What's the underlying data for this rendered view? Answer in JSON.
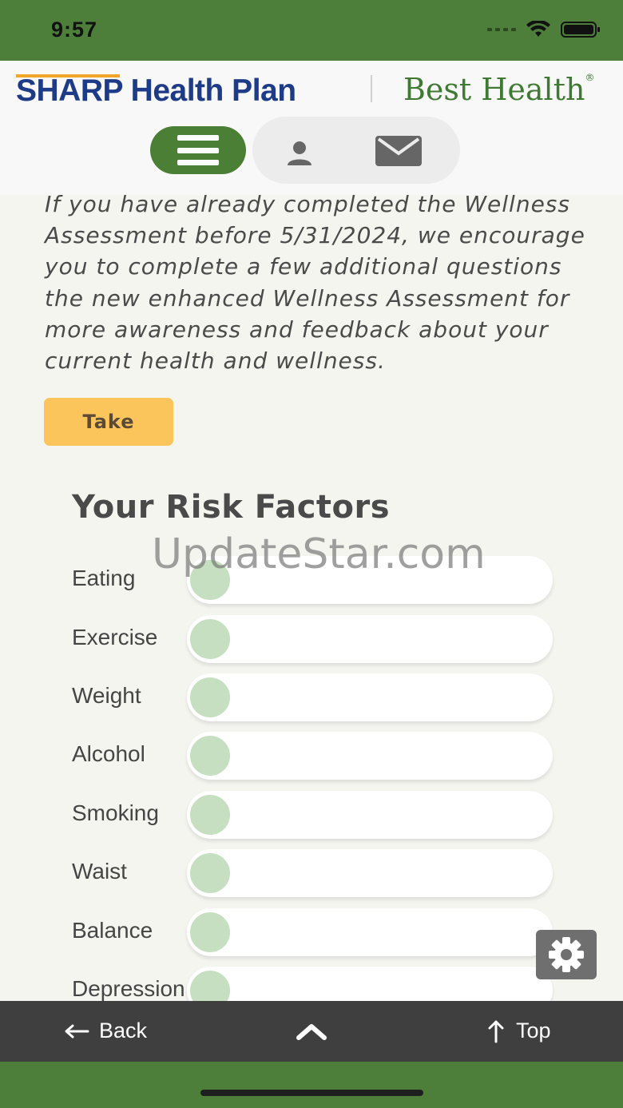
{
  "status_bar": {
    "time": "9:57"
  },
  "header": {
    "logo_sharp": "SHARP Health Plan",
    "logo_best": "Best Health",
    "logo_best_mark": "®",
    "brand_green": "#4a7f35",
    "brand_blue": "#1d3b86"
  },
  "intro": {
    "text": "If you have already completed the Wellness Assessment before 5/31/2024, we encourage you to complete a few additional questions the new enhanced Wellness Assessment for more awareness and feedback about your current health and wellness.",
    "take_label": "Take",
    "take_color": "#fcc55b"
  },
  "risk": {
    "title": "Your Risk Factors",
    "items": [
      {
        "label": "Eating"
      },
      {
        "label": "Exercise"
      },
      {
        "label": "Weight"
      },
      {
        "label": "Alcohol"
      },
      {
        "label": "Smoking"
      },
      {
        "label": "Waist"
      },
      {
        "label": "Balance"
      },
      {
        "label": "Depression"
      }
    ],
    "fill_color": "#c5dfc0"
  },
  "watermark": "UpdateStar.com",
  "bottom_nav": {
    "back_label": "Back",
    "top_label": "Top"
  },
  "icons": {
    "menu": "hamburger-icon",
    "user": "user-icon",
    "mail": "mail-icon",
    "settings": "gear-icon",
    "back": "arrow-left-icon",
    "up": "chevron-up-icon",
    "top": "arrow-up-icon"
  }
}
